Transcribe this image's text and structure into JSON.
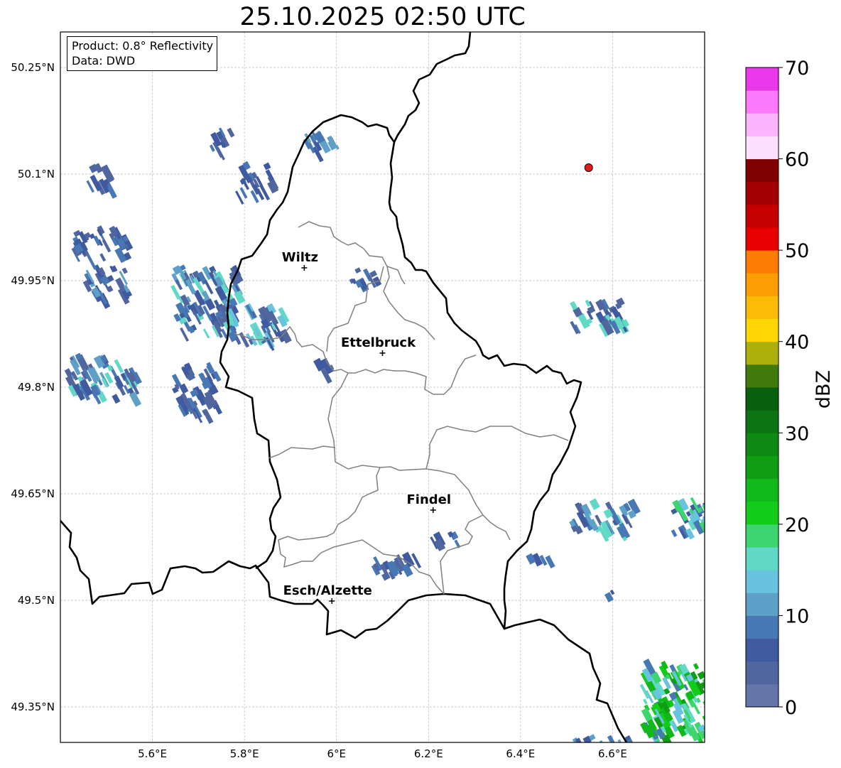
{
  "title": "25.10.2025 02:50 UTC",
  "info": {
    "product": "Product: 0.8° Reflectivity",
    "source": "Data: DWD"
  },
  "map": {
    "lon_range": [
      5.4,
      6.8
    ],
    "lat_range": [
      49.3,
      50.3
    ],
    "lon_ticks": [
      {
        "value": 5.6,
        "label": "5.6°E"
      },
      {
        "value": 5.8,
        "label": "5.8°E"
      },
      {
        "value": 6.0,
        "label": "6°E"
      },
      {
        "value": 6.2,
        "label": "6.2°E"
      },
      {
        "value": 6.4,
        "label": "6.4°E"
      },
      {
        "value": 6.6,
        "label": "6.6°E"
      }
    ],
    "lat_ticks": [
      {
        "value": 50.25,
        "label": "50.25°N"
      },
      {
        "value": 50.1,
        "label": "50.1°N"
      },
      {
        "value": 49.95,
        "label": "49.95°N"
      },
      {
        "value": 49.8,
        "label": "49.8°N"
      },
      {
        "value": 49.65,
        "label": "49.65°N"
      },
      {
        "value": 49.5,
        "label": "49.5°N"
      },
      {
        "value": 49.35,
        "label": "49.35°N"
      }
    ],
    "cities": [
      {
        "name": "Wiltz",
        "lon": 5.93,
        "lat": 49.968
      },
      {
        "name": "Ettelbruck",
        "lon": 6.1,
        "lat": 49.848
      },
      {
        "name": "Findel",
        "lon": 6.21,
        "lat": 49.627
      },
      {
        "name": "Esch/Alzette",
        "lon": 5.99,
        "lat": 49.499
      }
    ],
    "marker": {
      "lon": 6.548,
      "lat": 50.109,
      "color": "#e41a1c"
    }
  },
  "colorbar": {
    "label": "dBZ",
    "min": 0,
    "max": 70,
    "ticks": [
      "0",
      "10",
      "20",
      "30",
      "40",
      "50",
      "60",
      "70"
    ],
    "colors": [
      "#6475a7",
      "#51669f",
      "#405a9f",
      "#4878b3",
      "#5ea0c8",
      "#67c3de",
      "#62d9c7",
      "#3cd56f",
      "#12cc19",
      "#10b81a",
      "#0f9e13",
      "#0d8a14",
      "#0c7413",
      "#0a5f0d",
      "#3f7a0b",
      "#adaf0b",
      "#fdd604",
      "#fcbb04",
      "#fc9d03",
      "#fc7d02",
      "#e60000",
      "#c40000",
      "#a20000",
      "#7e0000",
      "#fde0fd",
      "#fcb5fc",
      "#fc79fc",
      "#ea38ea"
    ]
  }
}
